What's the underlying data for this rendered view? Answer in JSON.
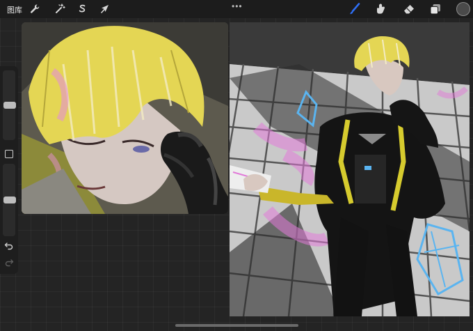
{
  "toolbar": {
    "gallery_label": "图库",
    "actions_icon": "wrench-icon",
    "adjustments_icon": "magic-wand-icon",
    "selection_icon": "selection-s-icon",
    "transform_icon": "arrow-cursor-icon",
    "menu_dots": "•••",
    "brush_icon": "brush-icon",
    "smudge_icon": "smudge-finger-icon",
    "eraser_icon": "eraser-icon",
    "layers_icon": "layers-icon",
    "current_color": "#4a4a4a",
    "accent_color": "#2f6ff5"
  },
  "sidebar": {
    "brush_size_level": 0.5,
    "opacity_level": 0.5,
    "modify_icon": "square-icon",
    "undo_icon": "undo-icon",
    "redo_icon": "redo-icon"
  },
  "canvas": {
    "portrait_image": "closeup-portrait-blond-character-black-glove",
    "full_image": "full-body-blond-character-black-jacket-holding-card"
  }
}
